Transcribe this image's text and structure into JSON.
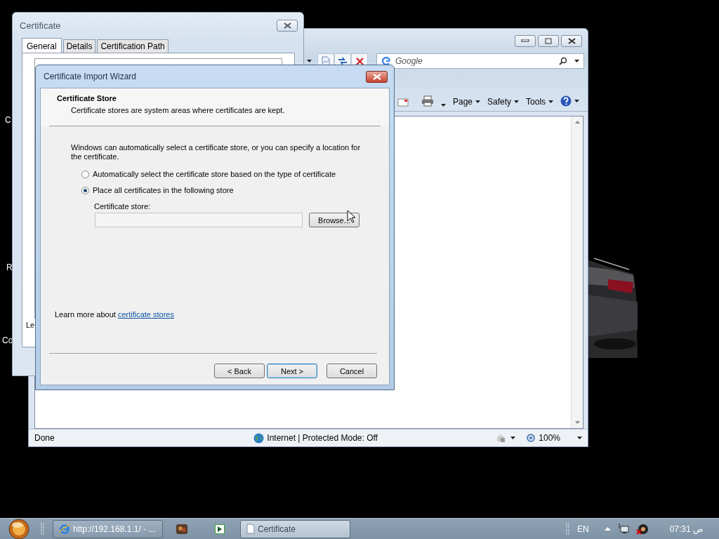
{
  "desktop_icons": [
    {
      "label": "C"
    },
    {
      "label": "R"
    },
    {
      "label": "Co"
    }
  ],
  "browser": {
    "search": {
      "placeholder": "Google"
    },
    "command_bar": [
      "Page",
      "Safety",
      "Tools"
    ],
    "status_bar": {
      "status": "Done",
      "zone": "Internet | Protected Mode: Off",
      "zoom": "100%"
    }
  },
  "certificate_dialog": {
    "title": "Certificate",
    "tabs": [
      {
        "label": "General",
        "selected": true
      },
      {
        "label": "Details",
        "selected": false
      },
      {
        "label": "Certification Path",
        "selected": false
      }
    ],
    "text": "Le"
  },
  "wizard": {
    "title": "Certificate Import Wizard",
    "heading": "Certificate Store",
    "subheading": "Certificate stores are system areas where certificates are kept.",
    "intro": "Windows can automatically select a certificate store, or you can specify a location for the certificate.",
    "options": [
      {
        "label": "Automatically select the certificate store based on the type of certificate",
        "selected": false
      },
      {
        "label": "Place all certificates in the following store",
        "selected": true
      }
    ],
    "store_label": "Certificate store:",
    "store_field": {
      "disabled": true
    },
    "browse": "Browse...",
    "learn_more": {
      "text": "Learn more about",
      "link": "certificate stores"
    },
    "buttons": [
      {
        "label": "< Back",
        "default": false
      },
      {
        "label": "Next >",
        "default": true
      },
      {
        "label": "Cancel",
        "default": false
      }
    ]
  },
  "taskbar": {
    "tasks": [
      {
        "kind": "browser",
        "label": "http://192.168.1.1/ - ...",
        "selected": false
      },
      {
        "kind": "document",
        "label": "Certificate",
        "selected": true
      }
    ],
    "language": "EN",
    "clock": "07:31 ص"
  }
}
